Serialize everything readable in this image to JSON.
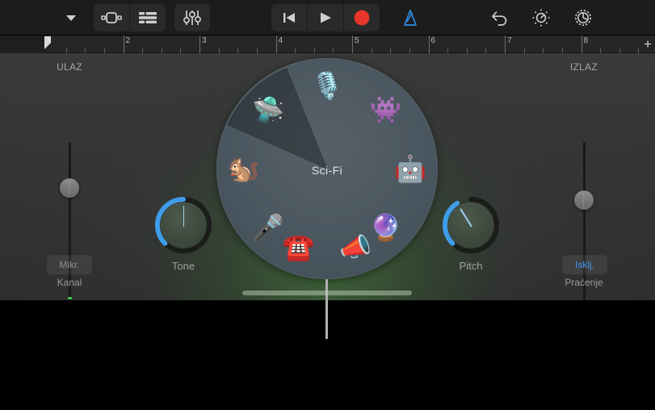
{
  "toolbar": {
    "nav_button": {
      "name": "chevron-down-icon",
      "label": ""
    },
    "view_tracks_button": {
      "name": "instrument-view-icon",
      "label": ""
    },
    "view_list_button": {
      "name": "track-list-icon",
      "label": ""
    },
    "mixer_button": {
      "name": "mixer-sliders-icon",
      "label": ""
    },
    "rewind_button": {
      "name": "rewind-icon",
      "label": ""
    },
    "play_button": {
      "name": "play-icon",
      "label": ""
    },
    "record_button": {
      "name": "record-icon",
      "label": ""
    },
    "metronome_button": {
      "name": "metronome-icon",
      "label": "",
      "active": true
    },
    "undo_button": {
      "name": "undo-icon",
      "label": ""
    },
    "fx_button": {
      "name": "fx-knob-icon",
      "label": ""
    },
    "settings_button": {
      "name": "gear-icon",
      "label": ""
    },
    "accent_blue": "#2f8fe8",
    "record_red": "#e8362a"
  },
  "ruler": {
    "bars": [
      "2",
      "3",
      "4",
      "5",
      "6",
      "7",
      "8"
    ],
    "add_label": "+",
    "playhead_bar": "1"
  },
  "input": {
    "title": "ULAZ",
    "channel_button": "Mikr.",
    "channel_label": "Kanal",
    "slider_value_pct": 72
  },
  "output": {
    "title": "IZLAZ",
    "monitor_button": "Isklj.",
    "monitor_label": "Praćenje",
    "slider_value_pct": 65,
    "monitor_button_color": "#3f96f2"
  },
  "tone_knob": {
    "label": "Tone",
    "value_deg": 0
  },
  "pitch_knob": {
    "label": "Pitch",
    "value_deg": -32
  },
  "wheel": {
    "selected_label": "Sci-Fi",
    "accent": "#4b5760",
    "items": [
      {
        "name": "wheel-item-monster",
        "glyph": "👾",
        "angle": 45,
        "label": "Monster"
      },
      {
        "name": "wheel-item-robot",
        "glyph": "🤖",
        "angle": 90,
        "label": "Robot"
      },
      {
        "name": "wheel-item-alien-orb",
        "glyph": "🔮",
        "angle": 135,
        "label": "Alien"
      },
      {
        "name": "wheel-item-megaphone",
        "glyph": "📣",
        "angle": 160,
        "label": "Megaphone"
      },
      {
        "name": "wheel-item-telephone",
        "glyph": "☎️",
        "angle": 200,
        "label": "Telephone"
      },
      {
        "name": "wheel-item-karaoke",
        "glyph": "🎤",
        "angle": 225,
        "label": "Karaoke"
      },
      {
        "name": "wheel-item-chipmunk",
        "glyph": "🐿️",
        "angle": 270,
        "label": "Chipmunk"
      },
      {
        "name": "wheel-item-scifi-ufo",
        "glyph": "🛸",
        "angle": 315,
        "label": "Sci-Fi"
      },
      {
        "name": "wheel-item-clean-mic",
        "glyph": "🎙️",
        "angle": 0,
        "label": "Clean"
      }
    ]
  }
}
